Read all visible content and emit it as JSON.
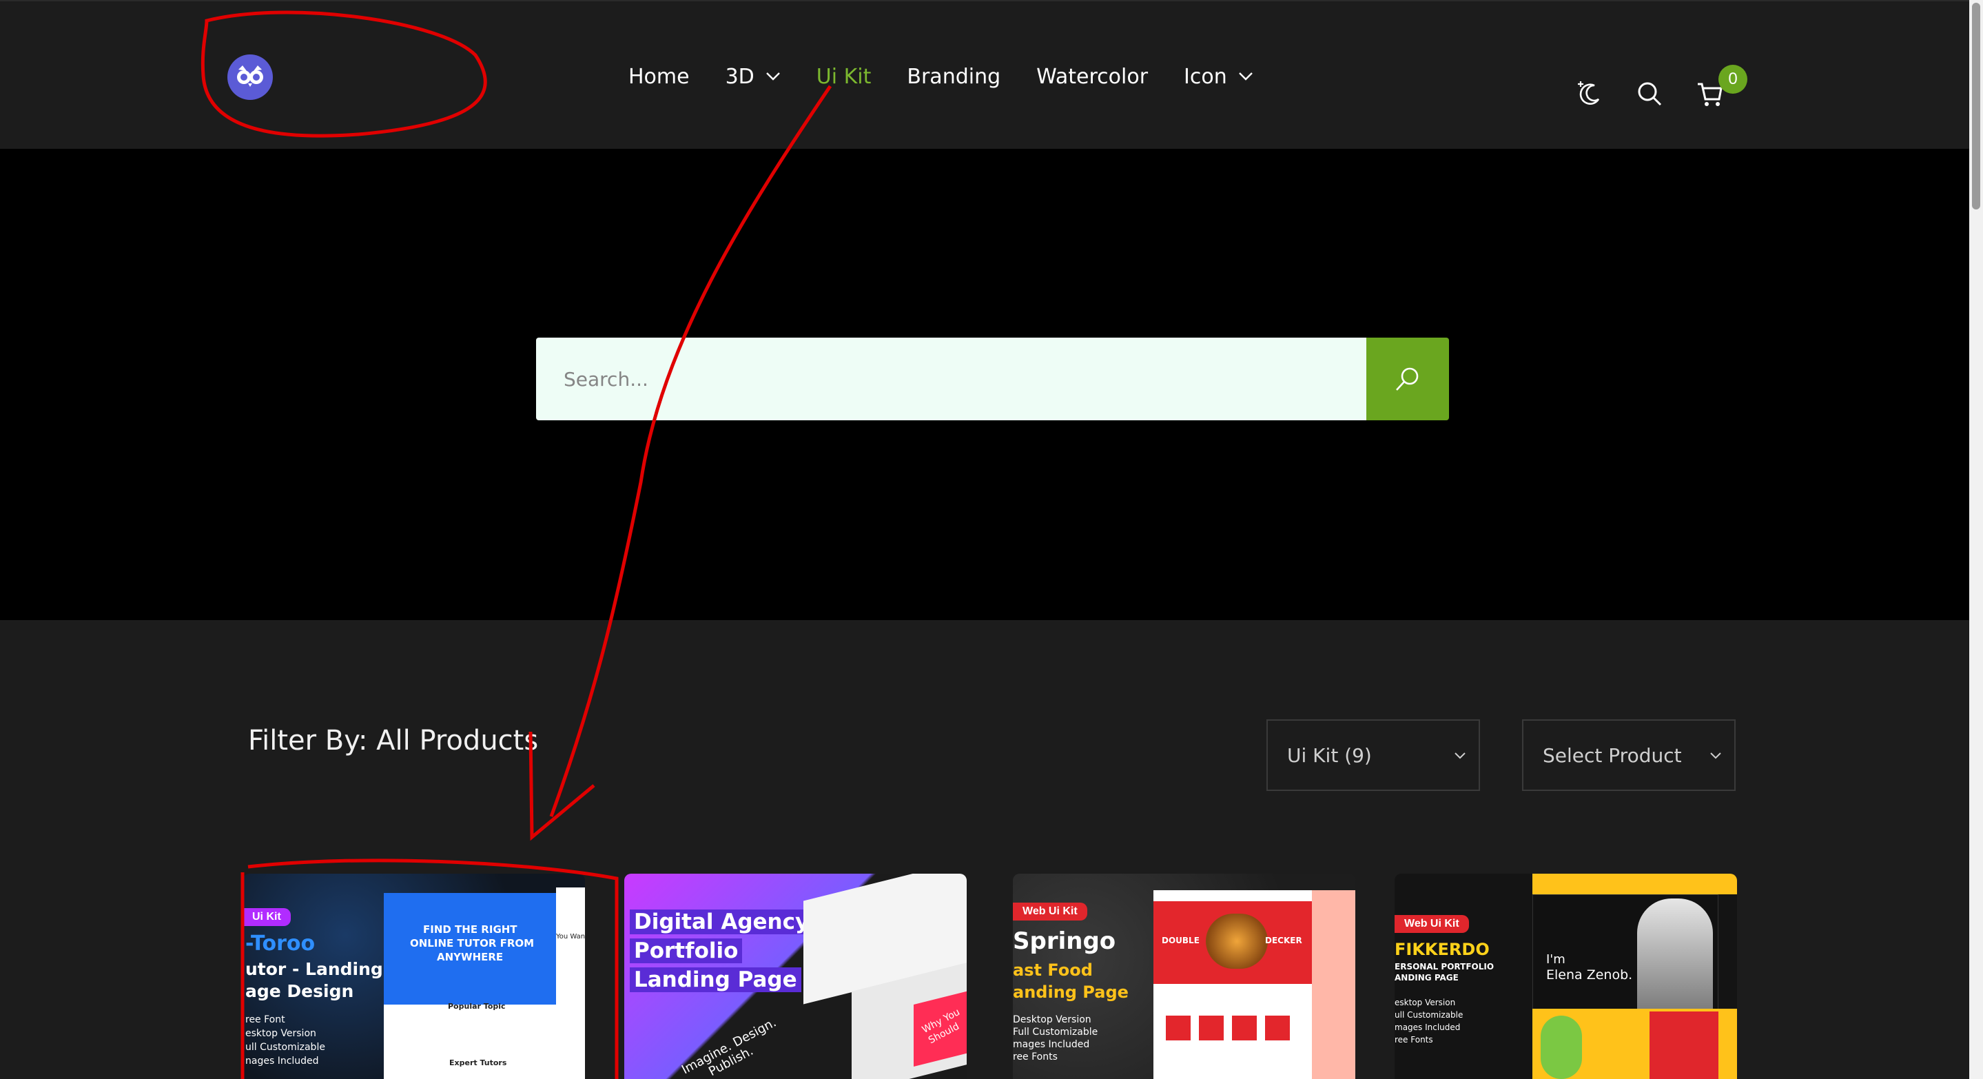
{
  "header": {
    "nav": [
      {
        "label": "Home",
        "dropdown": false,
        "active": false
      },
      {
        "label": "3D",
        "dropdown": true,
        "active": false
      },
      {
        "label": "Ui Kit",
        "dropdown": false,
        "active": true
      },
      {
        "label": "Branding",
        "dropdown": false,
        "active": false
      },
      {
        "label": "Watercolor",
        "dropdown": false,
        "active": false
      },
      {
        "label": "Icon",
        "dropdown": true,
        "active": false
      }
    ],
    "icons": [
      "dark-mode-moon-icon",
      "search-icon",
      "cart-icon"
    ],
    "cart_count": "0"
  },
  "hero": {
    "search_placeholder": "Search..."
  },
  "products": {
    "filter_label": "Filter By: All Products",
    "category_select": "Ui Kit (9)",
    "product_select": "Select Product",
    "cards": [
      {
        "tag": "Ui Kit",
        "title": "-Toroo",
        "subtitle_1": "utor - Landing",
        "subtitle_2": "age Design",
        "features": [
          "ree Font",
          "esktop Version",
          "ull Customizable",
          "nages Included"
        ],
        "hero_text_1": "FIND THE RIGHT",
        "hero_text_2": "ONLINE TUTOR FROM",
        "hero_text_3": "ANYWHERE",
        "section_1": "Popular Topic",
        "section_2": "Expert Tutors",
        "side_text": "You Want"
      },
      {
        "title_1": "Digital Agency",
        "title_2": "Portfolio",
        "title_3": "Landing Page",
        "overlay_1": "Imagine. Design.",
        "overlay_2": "Publish.",
        "overlay_3": "Why You",
        "overlay_4": "Should"
      },
      {
        "tag": "Web Ui Kit",
        "title": "Springo",
        "subtitle_1": "ast Food",
        "subtitle_2": "anding Page",
        "features": [
          "Desktop Version",
          "Full Customizable",
          "mages Included",
          "ree Fonts"
        ],
        "banner_left": "DOUBLE",
        "banner_right": "DECKER"
      },
      {
        "tag": "Web Ui Kit",
        "title": "FIKKERDO",
        "subtitle_1": "ERSONAL PORTFOLIO",
        "subtitle_2": "ANDING PAGE",
        "features": [
          "esktop Version",
          "ull Customizable",
          "mages Included",
          "ree Fonts"
        ],
        "hero_1": "I'm",
        "hero_2": "Elena Zenob."
      }
    ]
  },
  "colors": {
    "accent": "#6aa61f",
    "active_nav": "#7cb82f",
    "header_bg": "#1c1c1c",
    "hero_bg": "#000000",
    "annotation": "#e00000"
  }
}
